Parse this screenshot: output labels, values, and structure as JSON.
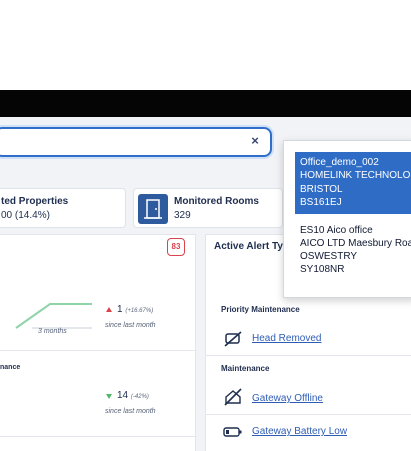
{
  "search": {
    "clear_icon": "×"
  },
  "kpis": [
    {
      "title": "ted Properties",
      "value": "00 (14.4%)"
    },
    {
      "title": "Monitored Rooms",
      "value": "329",
      "icon": "door-icon"
    }
  ],
  "left_panel": {
    "badge": "83",
    "trend1": {
      "value": "1",
      "pct": "(+16.67%)",
      "direction": "up",
      "since": "since last month",
      "chart_label": "3 months"
    },
    "section2_title": "nance",
    "trend2": {
      "value": "14",
      "pct": "(-42%)",
      "direction": "down",
      "since": "since last month"
    }
  },
  "right_panel": {
    "title": "Active Alert Ty",
    "groups": [
      {
        "label": "Priority Maintenance",
        "items": [
          {
            "label": "Head Removed",
            "icon": "head-removed-icon"
          }
        ]
      },
      {
        "label": "Maintenance",
        "items": [
          {
            "label": "Gateway Offline",
            "icon": "gateway-offline-icon"
          },
          {
            "label": "Gateway Battery Low",
            "icon": "battery-low-icon"
          }
        ]
      }
    ]
  },
  "dropdown": {
    "options": [
      {
        "lines": [
          "Office_demo_002",
          "HOMELINK TECHNOLO",
          "BRISTOL",
          "BS161EJ"
        ],
        "selected": true
      },
      {
        "lines": [
          "ES10 Aico office",
          "AICO LTD Maesbury Roa",
          "OSWESTRY",
          "SY108NR"
        ],
        "selected": false
      }
    ]
  },
  "colors": {
    "accent": "#2e6cc6",
    "alert_red": "#d9434d",
    "positive_green": "#4fb86a",
    "link": "#2f5db5"
  }
}
